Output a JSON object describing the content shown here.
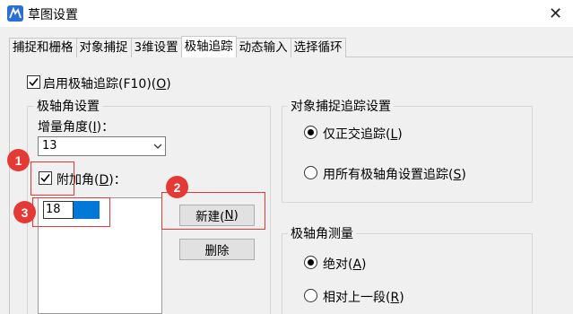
{
  "window": {
    "title": "草图设置",
    "close_glyph": "✕",
    "icon": "cad-app-icon"
  },
  "tabs": [
    {
      "label": "捕捉和栅格",
      "active": false
    },
    {
      "label": "对象捕捉",
      "active": false
    },
    {
      "label": "3维设置",
      "active": false
    },
    {
      "label": "极轴追踪",
      "active": true
    },
    {
      "label": "动态输入",
      "active": false
    },
    {
      "label": "选择循环",
      "active": false
    }
  ],
  "enable_polar": {
    "text": "启用极轴追踪(F10)(",
    "key": "O",
    "suffix": ")",
    "checked": true
  },
  "polar_angle_group": {
    "title": "极轴角设置",
    "increment_label": {
      "text": "增量角度(",
      "key": "I",
      "suffix": ")："
    },
    "increment_value": "13",
    "additional_label": {
      "text": "附加角(",
      "key": "D",
      "suffix": ")：",
      "checked": true
    },
    "additional_list": [
      "18"
    ],
    "new_button": {
      "text": "新建(",
      "key": "N",
      "suffix": ")"
    },
    "delete_button": "删除"
  },
  "object_snap_group": {
    "title": "对象捕捉追踪设置",
    "options": [
      {
        "text": "仅正交追踪(",
        "key": "L",
        "suffix": ")",
        "selected": true
      },
      {
        "text": "用所有极轴角设置追踪(",
        "key": "S",
        "suffix": ")",
        "selected": false
      }
    ]
  },
  "polar_measure_group": {
    "title": "极轴角测量",
    "options": [
      {
        "text": "绝对(",
        "key": "A",
        "suffix": ")",
        "selected": true
      },
      {
        "text": "相对上一段(",
        "key": "R",
        "suffix": ")",
        "selected": false
      }
    ]
  },
  "annotations": {
    "marker_1": "1",
    "marker_2": "2",
    "marker_3": "3",
    "color": "#e53935"
  },
  "colors": {
    "accent": "#0078d7",
    "annotation": "#e53935",
    "window_bg": "#f0f0f0"
  }
}
